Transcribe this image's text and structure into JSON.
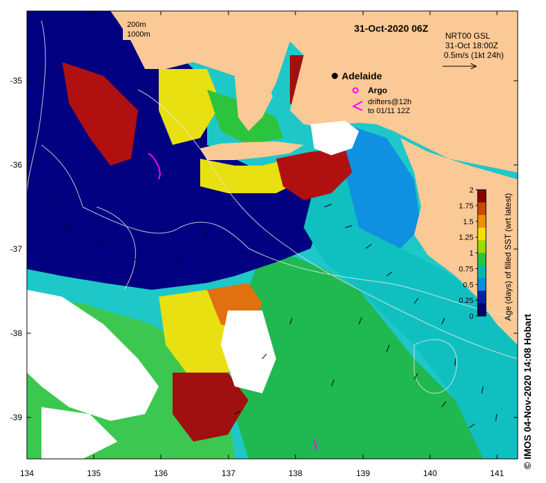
{
  "map": {
    "title": "31-Oct-2020 06Z",
    "contours": [
      "200m",
      "1000m"
    ],
    "city": "Adelaide",
    "argo_label": "Argo",
    "drifters_label": [
      "drifters@12h",
      "to 01/11 12Z"
    ],
    "vector_info": [
      "NRT00 GSL",
      "31-Oct 18:00Z",
      "0.5m/s (1kt 24h)"
    ],
    "credit": "© IMOS 04-Nov-2020 14:08 Hobart",
    "x_ticks": [
      "134",
      "135",
      "136",
      "137",
      "138",
      "139",
      "140",
      "141"
    ],
    "y_ticks": [
      "-35",
      "-36",
      "-37",
      "-38",
      "-39"
    ],
    "colorbar": {
      "title": "Age (days) of filled SST (wrt latest)",
      "ticks": [
        "2",
        "1.75",
        "1.5",
        "1.25",
        "1",
        "0.75",
        "0.5",
        "0.25",
        "0"
      ],
      "colors": [
        "#8b0000",
        "#c84a00",
        "#f09000",
        "#f7e000",
        "#9bdc00",
        "#2cc43c",
        "#00b8b0",
        "#0a8cdc",
        "#0020a8",
        "#000070"
      ]
    }
  },
  "colors": {
    "land": "#fbc996",
    "no_data": "#ffffff",
    "argo": "#ff00ff"
  }
}
